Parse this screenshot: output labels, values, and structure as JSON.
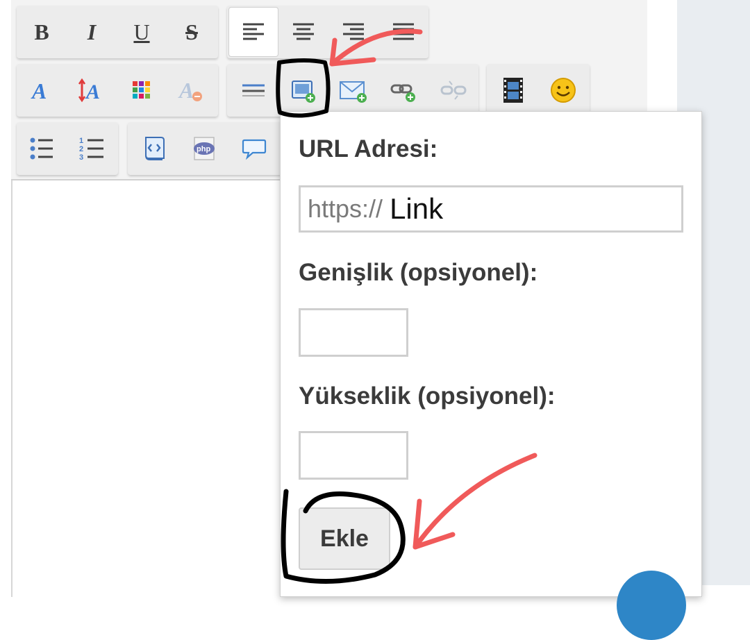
{
  "toolbar": {
    "text_style": [
      {
        "name": "bold",
        "glyph": "B"
      },
      {
        "name": "italic",
        "glyph": "I"
      },
      {
        "name": "underline",
        "glyph": "U"
      },
      {
        "name": "strikethrough",
        "glyph": "S"
      }
    ],
    "alignment": [
      "align-left-icon",
      "align-center-icon",
      "align-right-icon",
      "justify-icon"
    ],
    "font_tools": [
      "font-family-icon",
      "font-size-icon",
      "color-palette-icon",
      "remove-format-icon"
    ],
    "insert_tools": [
      "horizontal-rule-icon",
      "insert-image-icon",
      "insert-email-icon",
      "insert-link-icon",
      "unlink-icon"
    ],
    "media_tools": [
      "insert-video-icon",
      "insert-smiley-icon"
    ],
    "list_tools": [
      "bulleted-list-icon",
      "numbered-list-icon"
    ],
    "code_tools": [
      "code-icon",
      "php-icon",
      "quote-icon"
    ]
  },
  "image_dialog": {
    "url_label": "URL Adresi:",
    "url_prefix": "https://",
    "url_value": "Link",
    "width_label": "Genişlik (opsiyonel):",
    "width_value": "",
    "height_label": "Yükseklik (opsiyonel):",
    "height_value": "",
    "submit_label": "Ekle"
  },
  "colors": {
    "annotation_arrow": "#f05a5a",
    "annotation_circle": "#000000",
    "fab": "#2e86c7"
  }
}
